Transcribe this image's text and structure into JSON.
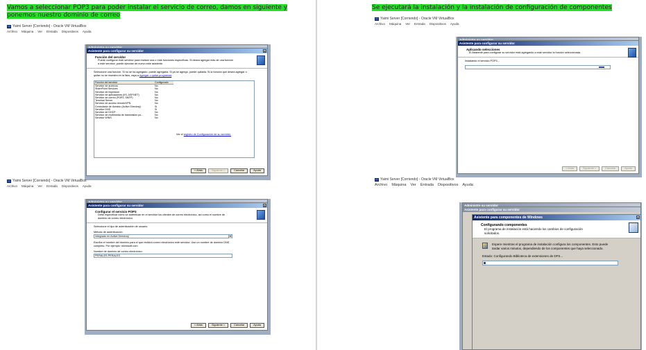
{
  "left": {
    "heading": "Vamos a seleccionar POP3 para poder instalar el servicio de correo, damos en siguiente y ponemos nuestro dominio de correo",
    "top_vm": {
      "title": "Yaimi Server [Corriendo] - Oracle VM VirtualBox",
      "menu": [
        "Archivo",
        "Máquina",
        "Ver",
        "Entrada",
        "Dispositivos",
        "Ayuda"
      ],
      "behind_title": "Administre su servidor",
      "wizard": {
        "title": "Asistente para configurar su servidor",
        "close": "x",
        "header_title": "Función del servidor",
        "header_sub": "Puede configurar este servidor para realizar una o más funciones específicas. Si desea agregar más de una función a este servidor, puede ejecutar de nuevo este asistente.",
        "intro": "Seleccione una función. Si no se ha agregado, puede agregarla. Si ya se agregó, puede quitarla. Si la función que desea agregar o quitar no se muestra en la lista, vaya a",
        "intro_link": "Agregar o quitar programas",
        "col1": "Función del servidor",
        "col2": "Configurado",
        "rows": [
          [
            "Servidor de archivos",
            "No"
          ],
          [
            "SharePoint Services",
            "No"
          ],
          [
            "Servidor de impresión",
            "No"
          ],
          [
            "Servidor de aplicaciones (IIS, ASP.NET)",
            "No"
          ],
          [
            "Servidor de correo (POP3, SMTP)",
            "No"
          ],
          [
            "Terminal Server",
            "No"
          ],
          [
            "Servidor de acceso remoto/VPN",
            "No"
          ],
          [
            "Controlador de dominio (Active Directory)",
            "Sí"
          ],
          [
            "Servidor DNS",
            "Sí"
          ],
          [
            "Servidor de DHCP",
            "No"
          ],
          [
            "Servidor de multimedia de transmisión po...",
            "No"
          ],
          [
            "Servidor WINS",
            "No"
          ]
        ],
        "log_text": "Ver el",
        "log_link": "registro de Configuración de su servidor.",
        "buttons": {
          "back": "< Atrás",
          "next": "Siguiente >",
          "cancel": "Cancelar",
          "help": "Ayuda"
        }
      }
    },
    "bottom_vm": {
      "title": "Yaimi Server [Corriendo] - Oracle VM VirtualBox",
      "menu": [
        "Archivo",
        "Máquina",
        "Ver",
        "Entrada",
        "Dispositivos",
        "Ayuda"
      ],
      "behind_title": "Administre su servidor",
      "wizard": {
        "title": "Asistente para configurar su servidor",
        "close": "x",
        "header_title": "Configurar el servicio POP3",
        "header_sub": "Debe especificar cómo se autentican en el servidor los clientes de correo electrónico, así como el nombre de dominio de correo electrónico.",
        "auth_prompt": "Seleccione el tipo de autenticación de usuario.",
        "method_label": "Método de autenticación:",
        "method_value": "Integrado en Active Directory",
        "domain_prompt": "Escriba el nombre del dominio para el que recibirá correo electrónico este servidor. Use un nombre de dominio DNS completo. Por ejemplo: microsoft.com",
        "domain_label": "Nombre de dominio de correo electrónico:",
        "domain_value": "PERALES.PERALES",
        "buttons": {
          "back": "< Atrás",
          "next": "Siguiente >",
          "cancel": "Cancelar",
          "help": "Ayuda"
        }
      }
    }
  },
  "right": {
    "heading": "Se ejecutará la instalación y la instalación de configuración de componentes",
    "top_vm": {
      "title": "Yaimi Server [Corriendo] - Oracle VM VirtualBox",
      "menu": [
        "Archivo",
        "Máquina",
        "Ver",
        "Entrada",
        "Dispositivos",
        "Ayuda"
      ],
      "behind_title": "Administre su servidor",
      "wizard": {
        "title": "Asistente para configurar su servidor",
        "header_title": "Aplicando selecciones",
        "header_sub": "El Asistente para configurar su servidor está agregando a este servidor la función seleccionada.",
        "status": "Instalando el servicio POP3...",
        "buttons": {
          "back": "< Atrás",
          "next": "Siguiente >",
          "cancel": "Cancelar",
          "help": "Ayuda"
        }
      }
    },
    "bottom_vm": {
      "title": "Yaimi Server [Corriendo] - Oracle VM VirtualBox",
      "menu": [
        "Archivo",
        "Máquina",
        "Ver",
        "Entrada",
        "Dispositivos",
        "Ayuda"
      ],
      "behind_title": "Administre su servidor",
      "behind_title2": "Asistente para configurar su servidor",
      "wizard": {
        "title": "Asistente para componentes de Windows",
        "close": "x",
        "header_title": "Configurando componentes",
        "header_sub": "El programa de instalación está haciendo los cambios de configuración solicitados.",
        "wait": "Espere mientras el programa de instalación configura los componentes. Esto puede tardar varios minutos, dependiendo de los componentes que haya seleccionado.",
        "status": "Estado:  Configurando Biblioteca de extensiones de DFS..."
      }
    }
  }
}
